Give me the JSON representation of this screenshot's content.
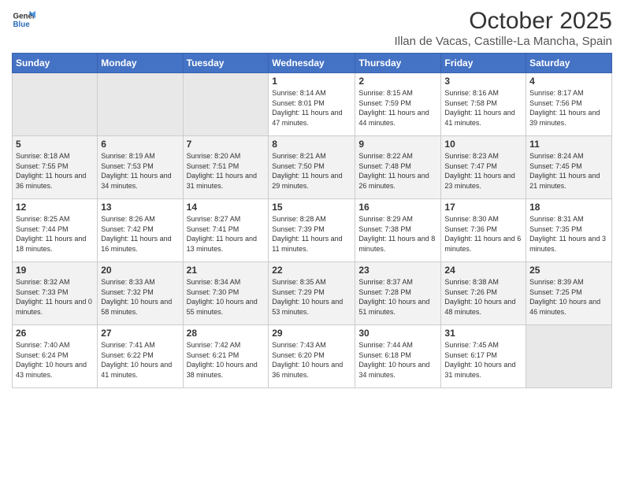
{
  "logo": {
    "general": "General",
    "blue": "Blue"
  },
  "header": {
    "title": "October 2025",
    "subtitle": "Illan de Vacas, Castille-La Mancha, Spain"
  },
  "weekdays": [
    "Sunday",
    "Monday",
    "Tuesday",
    "Wednesday",
    "Thursday",
    "Friday",
    "Saturday"
  ],
  "weeks": [
    [
      {
        "day": "",
        "info": ""
      },
      {
        "day": "",
        "info": ""
      },
      {
        "day": "",
        "info": ""
      },
      {
        "day": "1",
        "info": "Sunrise: 8:14 AM\nSunset: 8:01 PM\nDaylight: 11 hours and 47 minutes."
      },
      {
        "day": "2",
        "info": "Sunrise: 8:15 AM\nSunset: 7:59 PM\nDaylight: 11 hours and 44 minutes."
      },
      {
        "day": "3",
        "info": "Sunrise: 8:16 AM\nSunset: 7:58 PM\nDaylight: 11 hours and 41 minutes."
      },
      {
        "day": "4",
        "info": "Sunrise: 8:17 AM\nSunset: 7:56 PM\nDaylight: 11 hours and 39 minutes."
      }
    ],
    [
      {
        "day": "5",
        "info": "Sunrise: 8:18 AM\nSunset: 7:55 PM\nDaylight: 11 hours and 36 minutes."
      },
      {
        "day": "6",
        "info": "Sunrise: 8:19 AM\nSunset: 7:53 PM\nDaylight: 11 hours and 34 minutes."
      },
      {
        "day": "7",
        "info": "Sunrise: 8:20 AM\nSunset: 7:51 PM\nDaylight: 11 hours and 31 minutes."
      },
      {
        "day": "8",
        "info": "Sunrise: 8:21 AM\nSunset: 7:50 PM\nDaylight: 11 hours and 29 minutes."
      },
      {
        "day": "9",
        "info": "Sunrise: 8:22 AM\nSunset: 7:48 PM\nDaylight: 11 hours and 26 minutes."
      },
      {
        "day": "10",
        "info": "Sunrise: 8:23 AM\nSunset: 7:47 PM\nDaylight: 11 hours and 23 minutes."
      },
      {
        "day": "11",
        "info": "Sunrise: 8:24 AM\nSunset: 7:45 PM\nDaylight: 11 hours and 21 minutes."
      }
    ],
    [
      {
        "day": "12",
        "info": "Sunrise: 8:25 AM\nSunset: 7:44 PM\nDaylight: 11 hours and 18 minutes."
      },
      {
        "day": "13",
        "info": "Sunrise: 8:26 AM\nSunset: 7:42 PM\nDaylight: 11 hours and 16 minutes."
      },
      {
        "day": "14",
        "info": "Sunrise: 8:27 AM\nSunset: 7:41 PM\nDaylight: 11 hours and 13 minutes."
      },
      {
        "day": "15",
        "info": "Sunrise: 8:28 AM\nSunset: 7:39 PM\nDaylight: 11 hours and 11 minutes."
      },
      {
        "day": "16",
        "info": "Sunrise: 8:29 AM\nSunset: 7:38 PM\nDaylight: 11 hours and 8 minutes."
      },
      {
        "day": "17",
        "info": "Sunrise: 8:30 AM\nSunset: 7:36 PM\nDaylight: 11 hours and 6 minutes."
      },
      {
        "day": "18",
        "info": "Sunrise: 8:31 AM\nSunset: 7:35 PM\nDaylight: 11 hours and 3 minutes."
      }
    ],
    [
      {
        "day": "19",
        "info": "Sunrise: 8:32 AM\nSunset: 7:33 PM\nDaylight: 11 hours and 0 minutes."
      },
      {
        "day": "20",
        "info": "Sunrise: 8:33 AM\nSunset: 7:32 PM\nDaylight: 10 hours and 58 minutes."
      },
      {
        "day": "21",
        "info": "Sunrise: 8:34 AM\nSunset: 7:30 PM\nDaylight: 10 hours and 55 minutes."
      },
      {
        "day": "22",
        "info": "Sunrise: 8:35 AM\nSunset: 7:29 PM\nDaylight: 10 hours and 53 minutes."
      },
      {
        "day": "23",
        "info": "Sunrise: 8:37 AM\nSunset: 7:28 PM\nDaylight: 10 hours and 51 minutes."
      },
      {
        "day": "24",
        "info": "Sunrise: 8:38 AM\nSunset: 7:26 PM\nDaylight: 10 hours and 48 minutes."
      },
      {
        "day": "25",
        "info": "Sunrise: 8:39 AM\nSunset: 7:25 PM\nDaylight: 10 hours and 46 minutes."
      }
    ],
    [
      {
        "day": "26",
        "info": "Sunrise: 7:40 AM\nSunset: 6:24 PM\nDaylight: 10 hours and 43 minutes."
      },
      {
        "day": "27",
        "info": "Sunrise: 7:41 AM\nSunset: 6:22 PM\nDaylight: 10 hours and 41 minutes."
      },
      {
        "day": "28",
        "info": "Sunrise: 7:42 AM\nSunset: 6:21 PM\nDaylight: 10 hours and 38 minutes."
      },
      {
        "day": "29",
        "info": "Sunrise: 7:43 AM\nSunset: 6:20 PM\nDaylight: 10 hours and 36 minutes."
      },
      {
        "day": "30",
        "info": "Sunrise: 7:44 AM\nSunset: 6:18 PM\nDaylight: 10 hours and 34 minutes."
      },
      {
        "day": "31",
        "info": "Sunrise: 7:45 AM\nSunset: 6:17 PM\nDaylight: 10 hours and 31 minutes."
      },
      {
        "day": "",
        "info": ""
      }
    ]
  ]
}
